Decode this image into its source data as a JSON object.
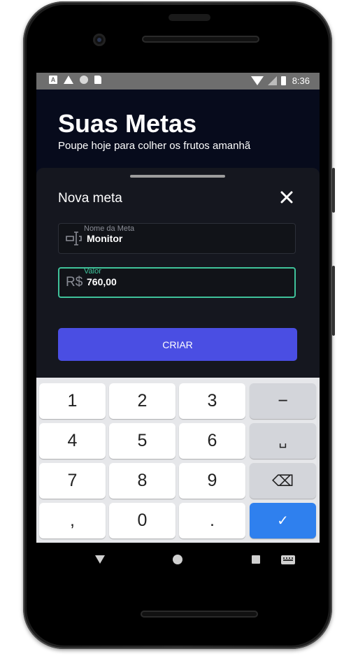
{
  "status_bar": {
    "notification_icons": [
      "a-icon",
      "warning-icon",
      "circle-icon",
      "sd-card-icon"
    ],
    "a_glyph": "A",
    "time": "8:36"
  },
  "header": {
    "title": "Suas Metas",
    "subtitle": "Poupe hoje para colher os frutos amanhã"
  },
  "sheet": {
    "title": "Nova meta",
    "close_icon": "close-icon",
    "name_field": {
      "label": "Nome da Meta",
      "value": "Monitor",
      "icon": "text-cursor-icon"
    },
    "value_field": {
      "label": "Valor",
      "prefix": "R$",
      "value": "760,00"
    },
    "create_label": "CRIAR",
    "accent_color": "#3fc29a",
    "button_color": "#4a4ee3"
  },
  "keyboard": {
    "rows": [
      [
        "1",
        "2",
        "3",
        "−"
      ],
      [
        "4",
        "5",
        "6",
        "␣"
      ],
      [
        "7",
        "8",
        "9",
        "⌫"
      ],
      [
        ",",
        "0",
        ".",
        "✓"
      ]
    ],
    "confirm_color": "#2f80ee"
  },
  "nav_bar": {
    "icons": [
      "back-icon",
      "home-icon",
      "recents-icon",
      "keyboard-icon"
    ]
  }
}
